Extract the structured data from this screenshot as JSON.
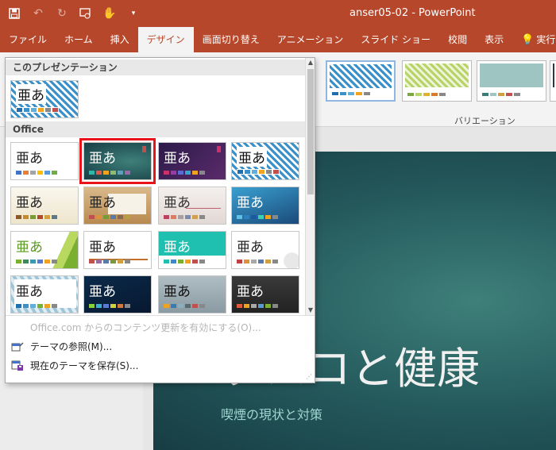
{
  "window": {
    "title": "anser05-02  -  PowerPoint"
  },
  "qat": {
    "save_icon": "save-icon",
    "undo_icon": "undo-icon",
    "redo_icon": "redo-icon",
    "present_icon": "present-from-start-icon",
    "touch_icon": "touch-mode-icon",
    "customize_icon": "customize-qat-icon"
  },
  "tabs": [
    {
      "label": "ファイル"
    },
    {
      "label": "ホーム"
    },
    {
      "label": "挿入"
    },
    {
      "label": "デザイン"
    },
    {
      "label": "画面切り替え"
    },
    {
      "label": "アニメーション"
    },
    {
      "label": "スライド ショー"
    },
    {
      "label": "校閲"
    },
    {
      "label": "表示"
    },
    {
      "label": "実行したい"
    }
  ],
  "ribbon": {
    "variations_label": "バリエーション"
  },
  "gallery": {
    "this_presentation_label": "このプレゼンテーション",
    "office_label": "Office",
    "glyph": "亜あ",
    "menu": {
      "enable_updates": "Office.com からのコンテンツ更新を有効にする(O)...",
      "browse_themes": "テーマの参照(M)...",
      "save_theme": "現在のテーマを保存(S)..."
    }
  },
  "slide": {
    "title": "タバコと健康",
    "subtitle": "喫煙の現状と対策"
  },
  "colors": {
    "accent": "#b7472a",
    "highlight": "#e8141a"
  }
}
